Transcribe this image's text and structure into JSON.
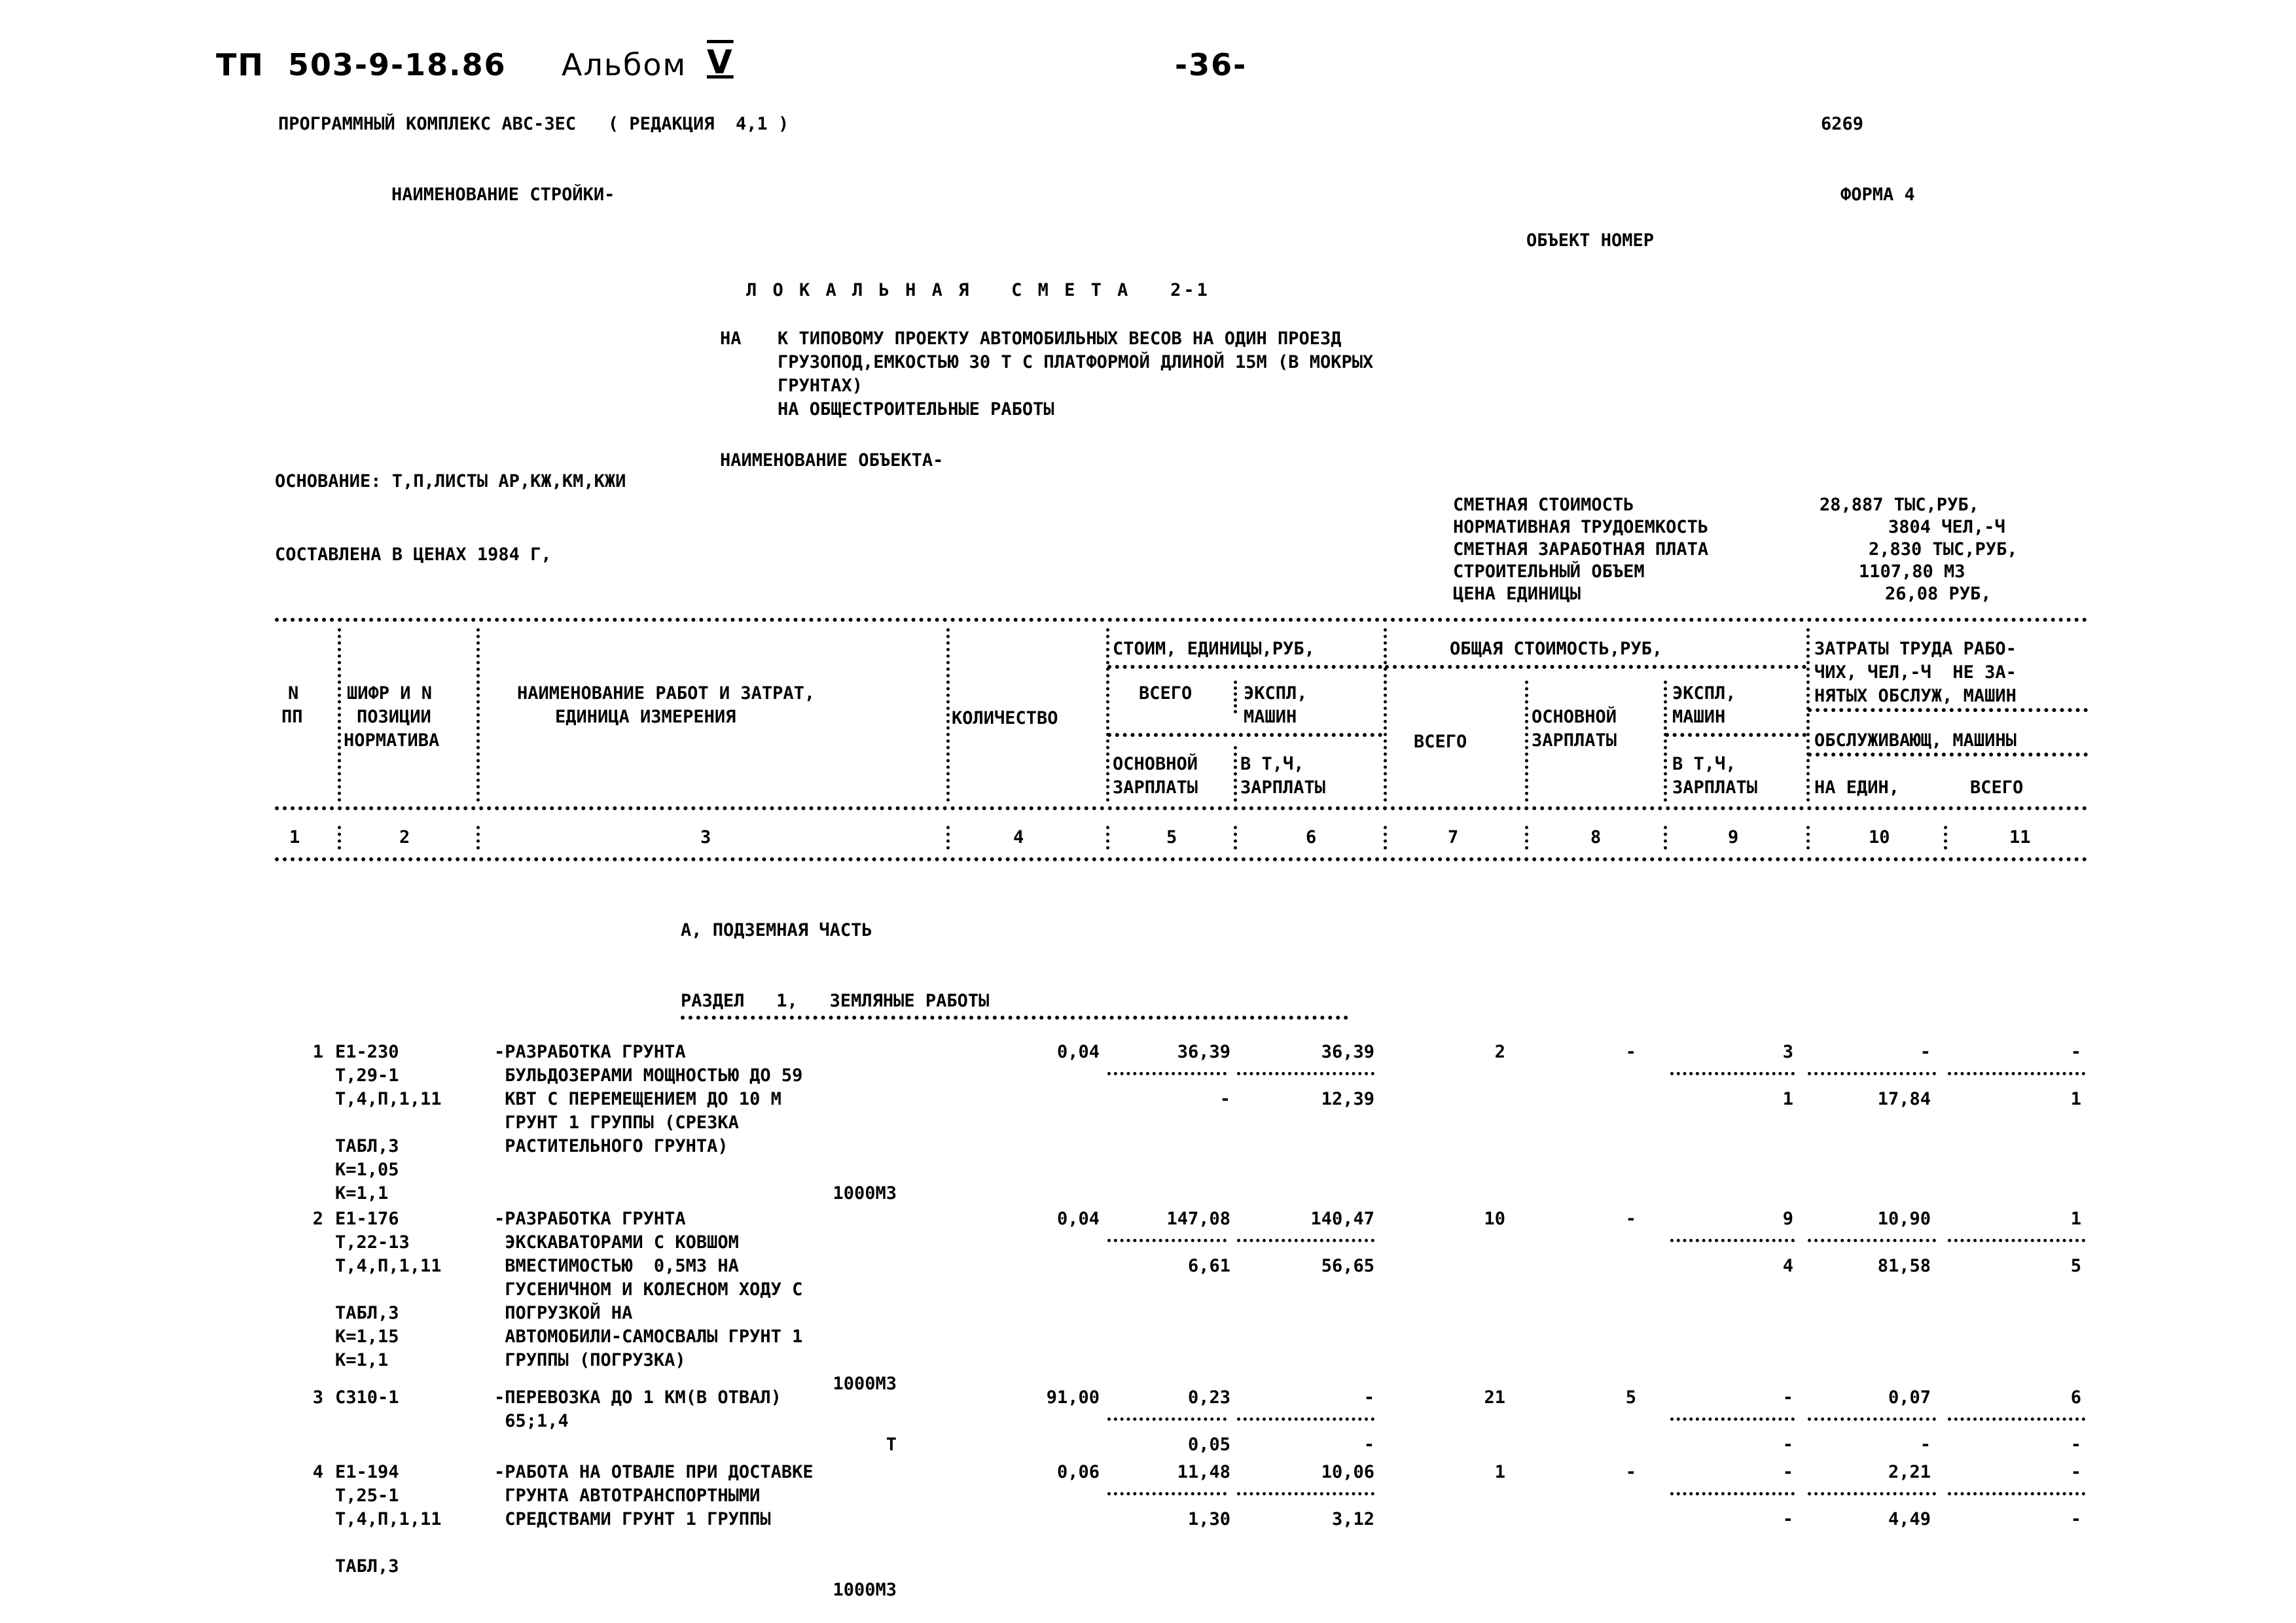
{
  "page_header": {
    "doc_code": "ТП  503-9-18.86",
    "album": "Альбом",
    "album_num": "V",
    "page_number": "-36-"
  },
  "program_line": {
    "text": "ПРОГРАММНЫЙ КОМПЛЕКС АВС-ЗЕС   ( РЕДАКЦИЯ  4,1 )",
    "code": "6269"
  },
  "line_name_label": "НАИМЕНОВАНИЕ СТРОЙКИ-",
  "form_label": "ФОРМА 4",
  "object_number_label": "ОБЪЕКТ НОМЕР",
  "title": "Л О К А Л Ь Н А Я   С М Е Т А   2-1",
  "subtitle": {
    "prefix": "НА",
    "lines": [
      "К ТИПОВОМУ ПРОЕКТУ АВТОМОБИЛЬНЫХ ВЕСОВ НА ОДИН ПРОЕЗД",
      "ГРУЗОПОД,ЕМКОСТЬЮ 30 Т С ПЛАТФОРМОЙ ДЛИНОЙ 15М (В МОКРЫХ",
      "ГРУНТАХ)",
      "НА ОБЩЕСТРОИТЕЛЬНЫЕ РАБОТЫ"
    ]
  },
  "object_name_label": "НАИМЕНОВАНИЕ ОБЪЕКТА-",
  "basis": "ОСНОВАНИЕ: Т,П,ЛИСТЫ АР,КЖ,КМ,КЖИ",
  "prices_line": "СОСТАВЛЕНА В ЦЕНАХ 1984 Г,",
  "summary": [
    {
      "label": "СМЕТНАЯ СТОИМОСТЬ",
      "value": "28,887 ТЫС,РУБ,"
    },
    {
      "label": "НОРМАТИВНАЯ ТРУДОЕМКОСТЬ",
      "value": "3804 ЧЕЛ,-Ч"
    },
    {
      "label": "СМЕТНАЯ ЗАРАБОТНАЯ ПЛАТА",
      "value": "2,830 ТЫС,РУБ,"
    },
    {
      "label": "СТРОИТЕЛЬНЫЙ ОБЪЕМ",
      "value": "1107,80 М3"
    },
    {
      "label": "ЦЕНА ЕДИНИЦЫ",
      "value": "26,08 РУБ,"
    }
  ],
  "table_header": {
    "col1": [
      "N",
      "ПП"
    ],
    "col2": [
      "ШИФР И N",
      "ПОЗИЦИИ",
      "НОРМАТИВА"
    ],
    "col3": [
      "НАИМЕНОВАНИЕ РАБОТ И ЗАТРАТ,",
      "ЕДИНИЦА ИЗМЕРЕНИЯ"
    ],
    "col4": "КОЛИЧЕСТВО",
    "unit_cost_group": "СТОИМ, ЕДИНИЦЫ,РУБ,",
    "unit_total": "ВСЕГО",
    "unit_machines": [
      "ЭКСПЛ,",
      "МАШИН"
    ],
    "unit_base_wage": [
      "ОСНОВНОЙ",
      "ЗАРПЛАТЫ"
    ],
    "unit_incl_wage": [
      "В Т,Ч,",
      "ЗАРПЛАТЫ"
    ],
    "total_cost_group": "ОБЩАЯ СТОИМОСТЬ,РУБ,",
    "total_all": "ВСЕГО",
    "total_base_wage": [
      "ОСНОВНОЙ",
      "ЗАРПЛАТЫ"
    ],
    "total_machines": [
      "ЭКСПЛ,",
      "МАШИН"
    ],
    "total_incl_wage": [
      "В Т,Ч,",
      "ЗАРПЛАТЫ"
    ],
    "labor_group": [
      "ЗАТРАТЫ ТРУДА РАБО-",
      "ЧИХ, ЧЕЛ,-Ч  НЕ ЗА-",
      "НЯТЫХ ОБСЛУЖ, МАШИН"
    ],
    "labor_sub": "ОБСЛУЖИВАЮЩ, МАШИНЫ",
    "labor_per_unit": "НА ЕДИН,",
    "labor_total": "ВСЕГО",
    "column_numbers": [
      "1",
      "2",
      "3",
      "4",
      "5",
      "6",
      "7",
      "8",
      "9",
      "10",
      "11"
    ]
  },
  "section_part": "А, ПОДЗЕМНАЯ ЧАСТЬ",
  "section_title": "РАЗДЕЛ   1,   ЗЕМЛЯНЫЕ РАБОТЫ",
  "rows": [
    {
      "n": "1",
      "code": [
        "Е1-230",
        "Т,29-1",
        "Т,4,П,1,11",
        "",
        "ТАБЛ,3",
        "К=1,05",
        "К=1,1"
      ],
      "name": [
        "-РАЗРАБОТКА ГРУНТА",
        " БУЛЬДОЗЕРАМИ МОЩНОСТЬЮ ДО 59",
        " КВТ С ПЕРЕМЕЩЕНИЕМ ДО 10 М",
        " ГРУНТ 1 ГРУППЫ (СРЕЗКА",
        " РАСТИТЕЛЬНОГО ГРУНТА)"
      ],
      "unit": "1000М3",
      "qty": "0,04",
      "unit_total": "36,39",
      "unit_machines": "36,39",
      "unit_wage": "-",
      "unit_machine_wage": "12,39",
      "total": "2",
      "total_wage": "-",
      "total_machines": "3",
      "total_machine_wage": "1",
      "labor_unit": "-",
      "labor_unit2": "17,84",
      "labor_total": "-",
      "labor_total2": "1"
    },
    {
      "n": "2",
      "code": [
        "Е1-176",
        "Т,22-13",
        "Т,4,П,1,11",
        "",
        "ТАБЛ,3",
        "К=1,15",
        "К=1,1"
      ],
      "name": [
        "-РАЗРАБОТКА ГРУНТА",
        " ЭКСКАВАТОРАМИ С КОВШОМ",
        " ВМЕСТИМОСТЬЮ  0,5М3 НА",
        " ГУСЕНИЧНОМ И КОЛЕСНОМ ХОДУ С",
        " ПОГРУЗКОЙ НА",
        " АВТОМОБИЛИ-САМОСВАЛЫ ГРУНТ 1",
        " ГРУППЫ (ПОГРУЗКА)"
      ],
      "unit": "1000М3",
      "qty": "0,04",
      "unit_total": "147,08",
      "unit_machines": "140,47",
      "unit_wage": "6,61",
      "unit_machine_wage": "56,65",
      "total": "10",
      "total_wage": "-",
      "total_machines": "9",
      "total_machine_wage": "4",
      "labor_unit": "10,90",
      "labor_unit2": "81,58",
      "labor_total": "1",
      "labor_total2": "5"
    },
    {
      "n": "3",
      "code": [
        "С310-1"
      ],
      "name": [
        "-ПЕРЕВОЗКА ДО 1 КМ(В ОТВАЛ)",
        " 65;1,4"
      ],
      "unit": "Т",
      "qty": "91,00",
      "unit_total": "0,23",
      "unit_machines": "-",
      "unit_wage": "0,05",
      "unit_machine_wage": "-",
      "total": "21",
      "total_wage": "5",
      "total_machines": "-",
      "total_machine_wage": "-",
      "labor_unit": "0,07",
      "labor_unit2": "-",
      "labor_total": "6",
      "labor_total2": "-"
    },
    {
      "n": "4",
      "code": [
        "Е1-194",
        "Т,25-1",
        "Т,4,П,1,11",
        "",
        "ТАБЛ,3"
      ],
      "name": [
        "-РАБОТА НА ОТВАЛЕ ПРИ ДОСТАВКЕ",
        " ГРУНТА АВТОТРАНСПОРТНЫМИ",
        " СРЕДСТВАМИ ГРУНТ 1 ГРУППЫ"
      ],
      "unit": "1000М3",
      "qty": "0,06",
      "unit_total": "11,48",
      "unit_machines": "10,06",
      "unit_wage": "1,30",
      "unit_machine_wage": "3,12",
      "total": "1",
      "total_wage": "-",
      "total_machines": "-",
      "total_machine_wage": "-",
      "labor_unit": "2,21",
      "labor_unit2": "4,49",
      "labor_total": "-",
      "labor_total2": "-"
    }
  ]
}
